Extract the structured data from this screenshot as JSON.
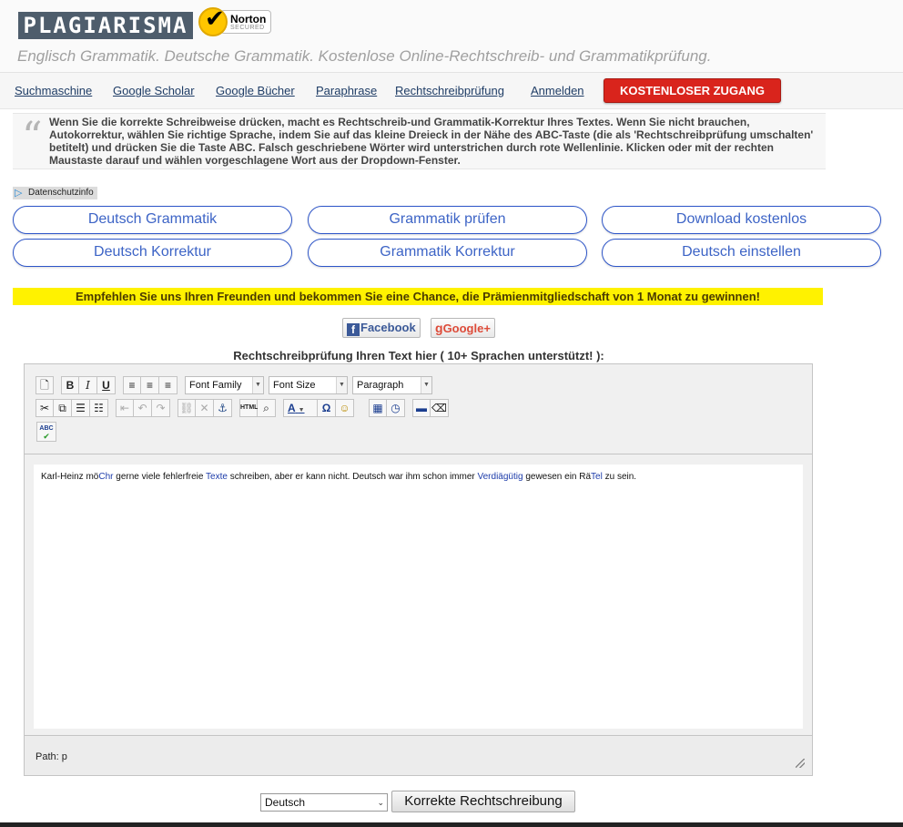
{
  "header": {
    "logo_text": "PLAGIARISMA",
    "badge": {
      "name": "Norton",
      "sub": "SECURED",
      "check": "✔"
    },
    "tagline": "Englisch Grammatik. Deutsche Grammatik. Kostenlose Online-Rechtschreib- und Grammatikprüfung."
  },
  "nav": {
    "links": [
      "Suchmaschine",
      "Google Scholar",
      "Google Bücher",
      "Paraphrase",
      "Rechtschreibprüfung",
      "Anmelden"
    ],
    "cta": "KOSTENLOSER ZUGANG"
  },
  "info": {
    "quote_mark": "“",
    "text": "Wenn Sie die korrekte Schreibweise drücken, macht es Rechtschreib-und Grammatik-Korrektur Ihres Textes. Wenn Sie nicht brauchen, Autokorrektur, wählen Sie richtige Sprache, indem Sie auf das kleine Dreieck in der Nähe des ABC-Taste (die als 'Rechtschreibprüfung umschalten' betitelt) und drücken Sie die Taste ABC. Falsch geschriebene Wörter wird unterstrichen durch rote Wellenlinie. Klicken oder mit der rechten Maustaste darauf und wählen vorgeschlagene Wort aus der Dropdown-Fenster.",
    "privacy": "Datenschutzinfo"
  },
  "links": [
    "Deutsch Grammatik",
    "Grammatik prüfen",
    "Download kostenlos",
    "Deutsch Korrektur",
    "Grammatik Korrektur",
    "Deutsch einstellen"
  ],
  "promo": "Empfehlen Sie uns Ihren Freunden und bekommen Sie eine Chance, die Prämienmitgliedschaft von 1 Monat zu gewinnen!",
  "social": {
    "facebook": {
      "icon": "f",
      "label": "Facebook"
    },
    "google": {
      "icon": "g",
      "label": "Google+"
    }
  },
  "checker": {
    "heading": "Rechtschreibprüfung Ihren Text hier ( 10+ Sprachen unterstützt! ):",
    "toolbar": {
      "font_family": "Font Family",
      "font_size": "Font Size",
      "format": "Paragraph",
      "icons": [
        "new-document",
        "bold",
        "italic",
        "underline",
        "align-left",
        "align-center",
        "align-right",
        "cut",
        "copy",
        "bullet-list",
        "numbered-list",
        "outdent",
        "undo",
        "redo",
        "link",
        "unlink",
        "anchor",
        "html",
        "cleanup",
        "text-color",
        "special-character",
        "emoticon",
        "insert-date",
        "insert-time",
        "horizontal-rule",
        "remove-format",
        "spellcheck"
      ],
      "labels": {
        "bold": "B",
        "italic": "I",
        "underline": "U",
        "html": "HTML",
        "omega": "Ω",
        "text_color": "A",
        "spell": "ABC"
      }
    },
    "content": {
      "t1": "Karl-Heinz mö",
      "e1": "Chr",
      "t2": " gerne viele fehlerfreie ",
      "e2": "Texte",
      "t3": " schreiben, aber er kann nicht. Deutsch war ihm schon immer ",
      "e3": "Verdiägütig",
      "t4": " gewesen ein Rä",
      "e4": "Tel",
      "t5": " zu sein."
    },
    "status_path": "Path: p"
  },
  "footer": {
    "language": "Deutsch",
    "submit": "Korrekte Rechtschreibung"
  },
  "colors": {
    "accent_red": "#d9241c",
    "pill_border": "#2d55c8",
    "promo_yellow": "#fff200",
    "error_text": "#1d3caa"
  }
}
